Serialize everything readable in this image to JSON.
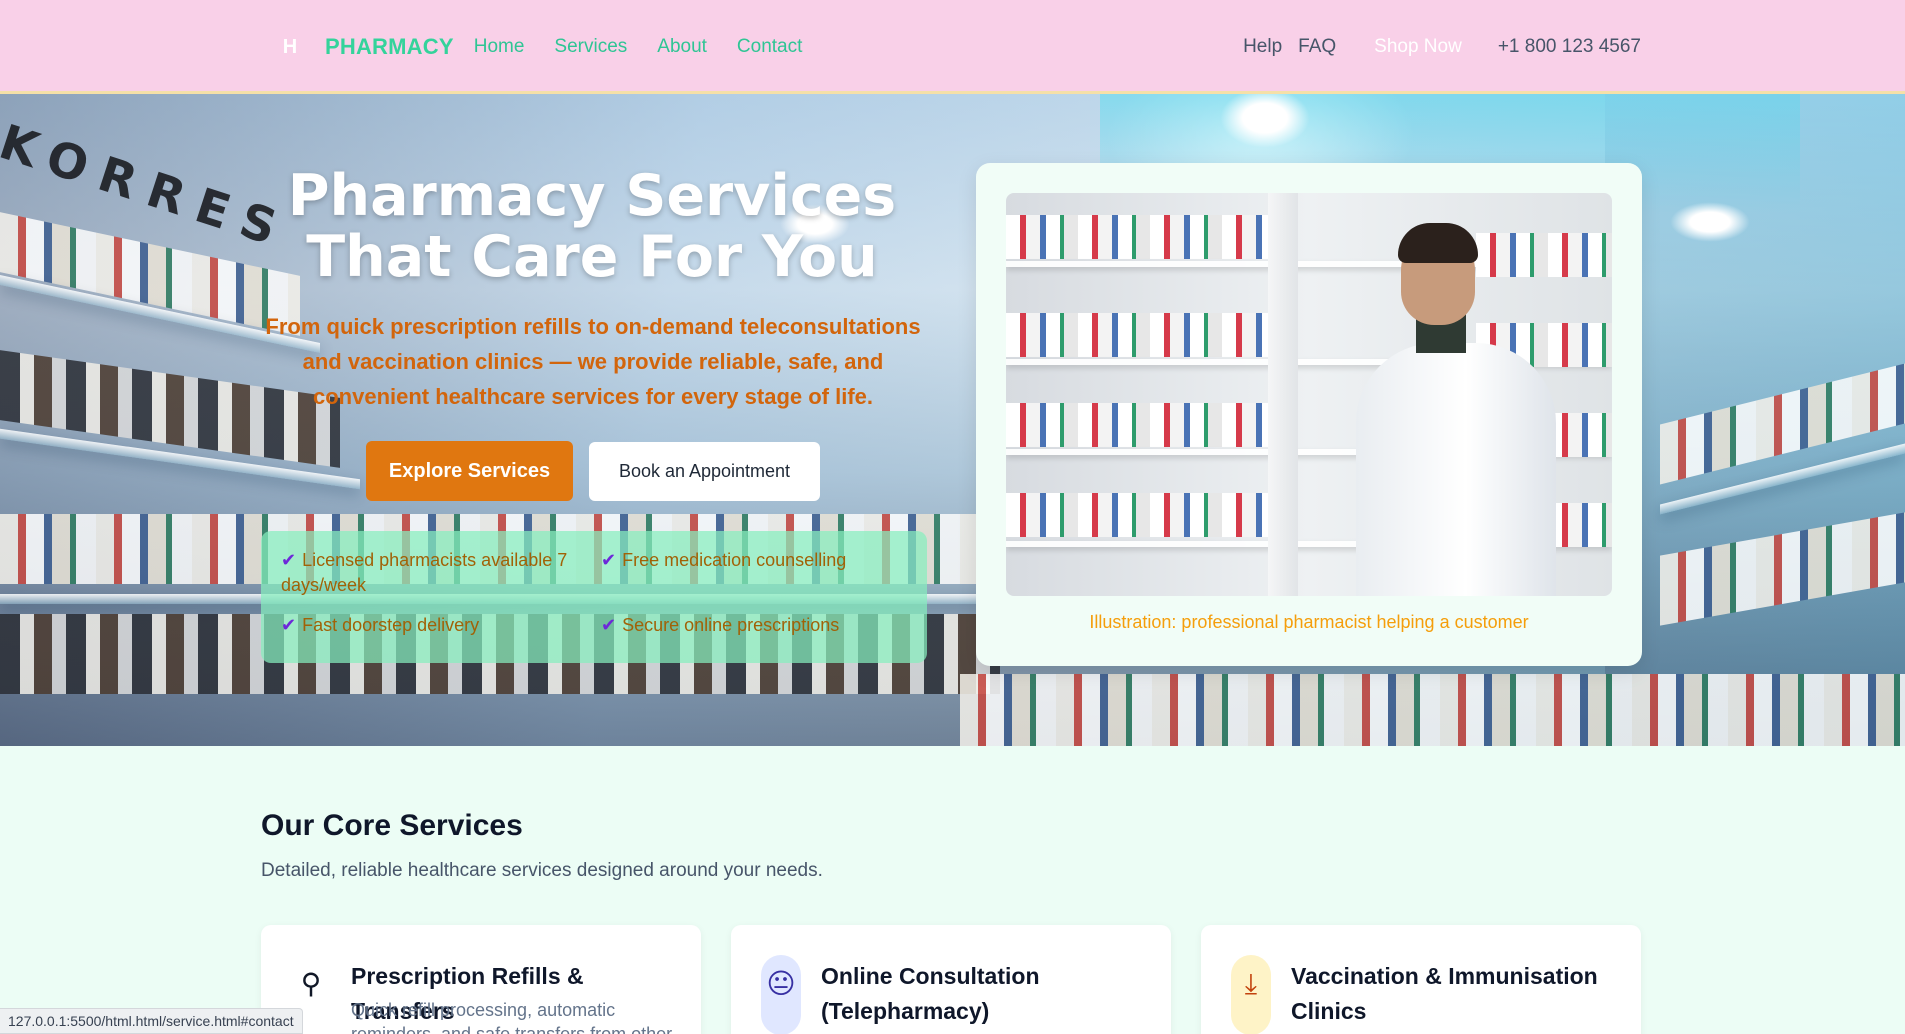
{
  "nav": {
    "logo_letter": "H",
    "brand": "PHARMACY",
    "links": [
      "Home",
      "Services",
      "About",
      "Contact"
    ],
    "help": "Help",
    "faq": "FAQ",
    "shop_now": "Shop Now",
    "phone": "+1 800 123 4567"
  },
  "hero": {
    "title": "Pharmacy Services That Care For You",
    "subtitle": "From quick prescription refills to on-demand teleconsultations and vaccination clinics — we provide reliable, safe, and convenient healthcare services for every stage of life.",
    "explore_label": "Explore Services",
    "book_label": "Book an Appointment",
    "features": [
      "Licensed pharmacists available 7 days/week",
      "Free medication counselling",
      "Fast doorstep delivery",
      "Secure online prescriptions"
    ],
    "background_text": "KORRES",
    "media_caption": "Illustration: professional pharmacist helping a customer"
  },
  "services": {
    "title": "Our Core Services",
    "subtitle": "Detailed, reliable healthcare services designed around your needs.",
    "cards": [
      {
        "title": "Prescription Refills & Transfers",
        "text": "Quick refill processing, automatic reminders, and safe transfers from other",
        "icon": "pill-icon",
        "icon_glyph": "⚲",
        "icon_bg": "#ffffff",
        "icon_color": "#111827"
      },
      {
        "title": "Online Consultation (Telepharmacy)",
        "text": "",
        "icon": "face-icon",
        "icon_glyph": "😐",
        "icon_bg": "#e0e7ff",
        "icon_color": "#3730a3"
      },
      {
        "title": "Vaccination & Immunisation Clinics",
        "text": "",
        "icon": "syringe-check-icon",
        "icon_glyph": "⤓",
        "icon_bg": "#fef3c7",
        "icon_color": "#c2410c"
      }
    ]
  },
  "status_bar": {
    "url": "127.0.0.1:5500/html.html/service.html#contact"
  },
  "colors": {
    "nav_bg": "#f9d0e8",
    "brand": "#34d39b",
    "accent_orange": "#e07710",
    "subtitle_orange": "#d2650c",
    "feature_panel": "#86efbe",
    "page_bg": "#ecfdf5"
  }
}
